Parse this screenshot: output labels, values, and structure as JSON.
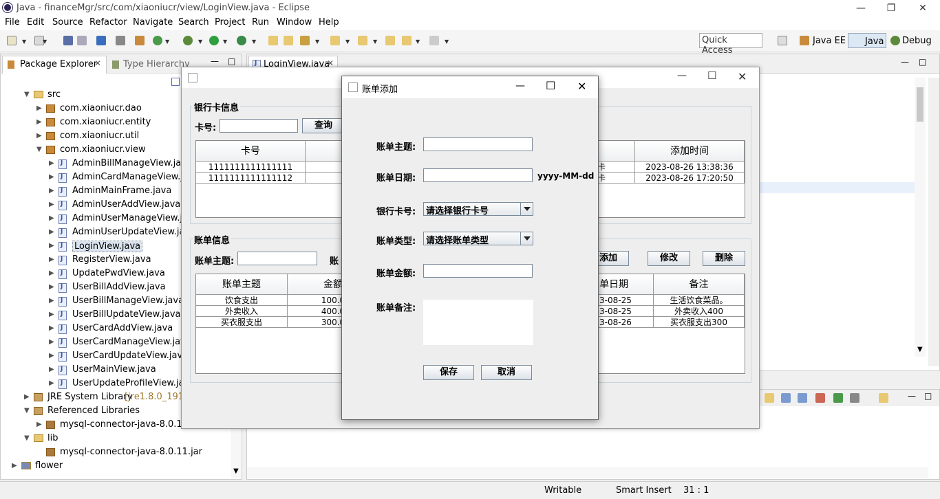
{
  "window": {
    "title": "Java - financeMgr/src/com/xiaoniucr/view/LoginView.java - Eclipse"
  },
  "menu": [
    "File",
    "Edit",
    "Source",
    "Refactor",
    "Navigate",
    "Search",
    "Project",
    "Run",
    "Window",
    "Help"
  ],
  "quick_access": "Quick Access",
  "perspectives": [
    "Java EE",
    "Java",
    "Debug"
  ],
  "explorer": {
    "tab_package": "Package Explorer",
    "tab_hierarchy": "Type Hierarchy",
    "tree": [
      {
        "label": "src",
        "level": 1,
        "kind": "src",
        "expanded": true
      },
      {
        "label": "com.xiaoniucr.dao",
        "level": 2,
        "kind": "pkg"
      },
      {
        "label": "com.xiaoniucr.entity",
        "level": 2,
        "kind": "pkg"
      },
      {
        "label": "com.xiaoniucr.util",
        "level": 2,
        "kind": "pkg"
      },
      {
        "label": "com.xiaoniucr.view",
        "level": 2,
        "kind": "pkg",
        "expanded": true
      },
      {
        "label": "AdminBillManageView.java",
        "level": 3,
        "kind": "java"
      },
      {
        "label": "AdminCardManageView.java",
        "level": 3,
        "kind": "java"
      },
      {
        "label": "AdminMainFrame.java",
        "level": 3,
        "kind": "java"
      },
      {
        "label": "AdminUserAddView.java",
        "level": 3,
        "kind": "java"
      },
      {
        "label": "AdminUserManageView.java",
        "level": 3,
        "kind": "java"
      },
      {
        "label": "AdminUserUpdateView.java",
        "level": 3,
        "kind": "java"
      },
      {
        "label": "LoginView.java",
        "level": 3,
        "kind": "java",
        "selected": true
      },
      {
        "label": "RegisterView.java",
        "level": 3,
        "kind": "java"
      },
      {
        "label": "UpdatePwdView.java",
        "level": 3,
        "kind": "java"
      },
      {
        "label": "UserBillAddView.java",
        "level": 3,
        "kind": "java"
      },
      {
        "label": "UserBillManageView.java",
        "level": 3,
        "kind": "java"
      },
      {
        "label": "UserBillUpdateView.java",
        "level": 3,
        "kind": "java"
      },
      {
        "label": "UserCardAddView.java",
        "level": 3,
        "kind": "java"
      },
      {
        "label": "UserCardManageView.java",
        "level": 3,
        "kind": "java"
      },
      {
        "label": "UserCardUpdateView.java",
        "level": 3,
        "kind": "java"
      },
      {
        "label": "UserMainView.java",
        "level": 3,
        "kind": "java"
      },
      {
        "label": "UserUpdateProfileView.java",
        "level": 3,
        "kind": "java"
      },
      {
        "label": "JRE System Library",
        "suffix": "[jre1.8.0_191]",
        "level": 1,
        "kind": "lib"
      },
      {
        "label": "Referenced Libraries",
        "level": 1,
        "kind": "lib",
        "expanded": true
      },
      {
        "label": "mysql-connector-java-8.0.11.jar",
        "level": 2,
        "kind": "jar"
      },
      {
        "label": "lib",
        "level": 1,
        "kind": "folder",
        "expanded": true
      },
      {
        "label": "mysql-connector-java-8.0.11.jar",
        "level": 2,
        "kind": "jar",
        "noarrow": true
      },
      {
        "label": "flower",
        "level": 0,
        "kind": "project"
      }
    ]
  },
  "editor_tab": "LoginView.java",
  "status": {
    "writable": "Writable",
    "insert": "Smart Insert",
    "position": "31 : 1"
  },
  "bg_window": {
    "card_group": "银行卡信息",
    "card_label": "卡号:",
    "query_btn": "查询",
    "card_headers": [
      "卡号",
      "",
      "添加时间"
    ],
    "card_rows": [
      [
        "1111111111111111",
        "",
        "卡",
        "2023-08-26 13:38:36"
      ],
      [
        "1111111111111112",
        "",
        "卡",
        "2023-08-26 17:20:50"
      ]
    ],
    "bill_group": "账单信息",
    "bill_subject_label": "账单主题:",
    "bill_cut_label": "账",
    "btn_add": "添加",
    "btn_edit": "修改",
    "btn_delete": "删除",
    "bill_headers": [
      "账单主题",
      "金额",
      "单日期",
      "备注"
    ],
    "bill_rows": [
      [
        "饮食支出",
        "100.0",
        "3-08-25",
        "生活饮食菜品。"
      ],
      [
        "外卖收入",
        "400.0",
        "3-08-25",
        "外卖收入400"
      ],
      [
        "买衣服支出",
        "300.0",
        "3-08-26",
        "买衣服支出300"
      ]
    ]
  },
  "dialog": {
    "title": "账单添加",
    "subject_label": "账单主题:",
    "date_label": "账单日期:",
    "date_hint": "yyyy-MM-dd",
    "card_label": "银行卡号:",
    "card_select": "请选择银行卡号",
    "type_label": "账单类型:",
    "type_select": "请选择账单类型",
    "amount_label": "账单金额:",
    "note_label": "账单备注:",
    "save_btn": "保存",
    "cancel_btn": "取消"
  }
}
